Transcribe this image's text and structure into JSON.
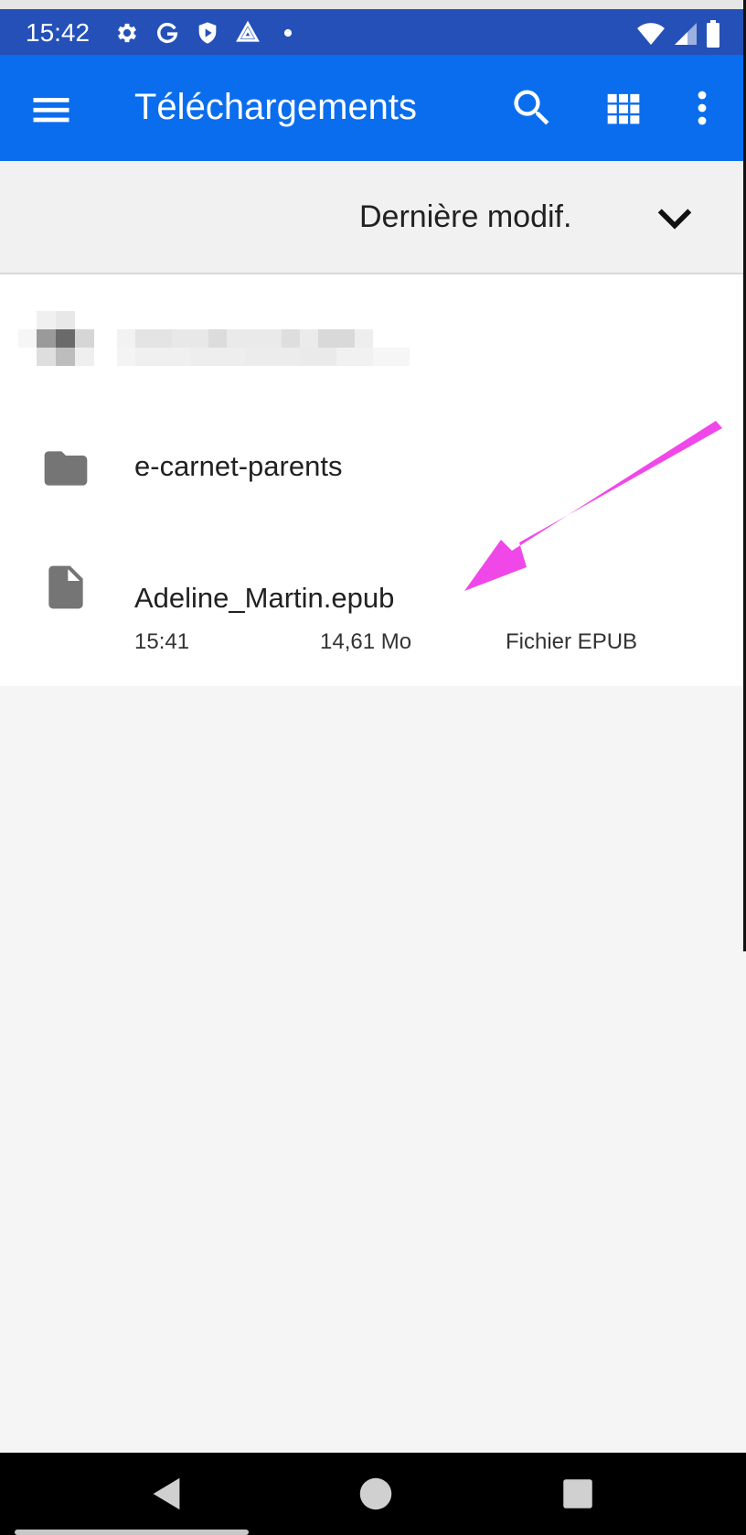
{
  "status_bar": {
    "time": "15:42",
    "icons": [
      "gear-icon",
      "google-g-icon",
      "shield-play-icon",
      "drive-icon",
      "dot-icon"
    ],
    "right_icons": [
      "wifi-icon",
      "signal-icon",
      "battery-icon"
    ]
  },
  "app_bar": {
    "title": "Téléchargements",
    "icons": [
      "menu-icon",
      "search-icon",
      "grid-view-icon",
      "more-vert-icon"
    ],
    "color": "#0a6ded"
  },
  "sort_bar": {
    "label": "Dernière modif.",
    "icon": "chevron-down-icon"
  },
  "list": {
    "items": [
      {
        "kind": "blurred",
        "name": ""
      },
      {
        "kind": "folder",
        "name": "e-carnet-parents"
      },
      {
        "kind": "file",
        "name": "Adeline_Martin.epub",
        "time": "15:41",
        "size": "14,61 Mo",
        "type": "Fichier EPUB"
      }
    ]
  },
  "annotation": {
    "icon": "arrow-pointer-icon",
    "color": "#f048e8"
  },
  "nav_bar": {
    "icons": [
      "back-icon",
      "home-icon",
      "recents-icon"
    ]
  }
}
